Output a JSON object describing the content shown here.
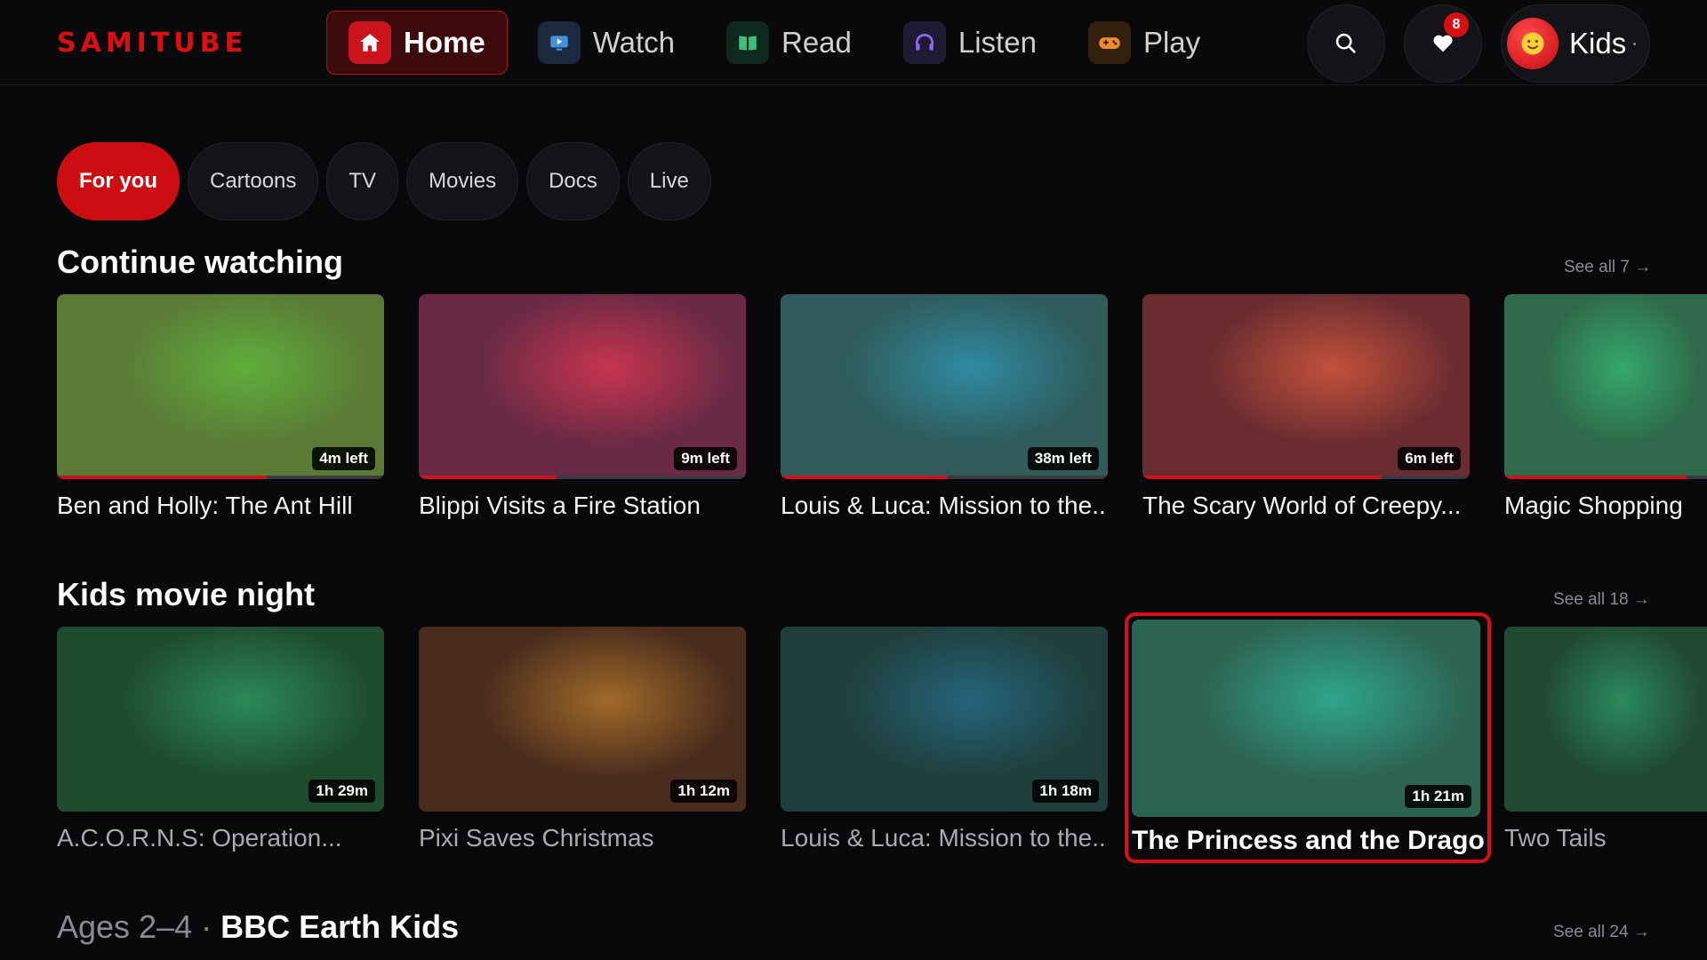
{
  "app": {
    "logo": "SAMITUBE"
  },
  "nav": [
    {
      "label": "Home",
      "icon": "home-icon",
      "color": "#c8141a",
      "active": true
    },
    {
      "label": "Watch",
      "icon": "tv-icon",
      "color": "#1b3a5c"
    },
    {
      "label": "Read",
      "icon": "book-icon",
      "color": "#13382a"
    },
    {
      "label": "Listen",
      "icon": "headphones-icon",
      "color": "#2c2246"
    },
    {
      "label": "Play",
      "icon": "gamepad-icon",
      "color": "#3d2614"
    }
  ],
  "header": {
    "search_icon": "search-icon",
    "favorites_icon": "heart-icon",
    "favorites_count": "8",
    "profile_name": "Kids",
    "avatar_icon": "smiley-icon"
  },
  "chips": [
    "For you",
    "Cartoons",
    "TV",
    "Movies",
    "Docs",
    "Live"
  ],
  "sections": {
    "continue": {
      "title": "Continue watching",
      "see_all": "See all 7 →",
      "items": [
        {
          "title": "Ben and Holly: The Ant Hill",
          "badge": "4m left",
          "progress": 0.64,
          "bg": "#5a7a36",
          "glow": "#5fae3a"
        },
        {
          "title": "Blippi Visits a Fire Station",
          "badge": "9m left",
          "progress": 0.42,
          "bg": "#6a2a45",
          "glow": "#c8344f"
        },
        {
          "title": "Louis & Luca: Mission to the...",
          "badge": "38m left",
          "progress": 0.51,
          "bg": "#2f5b5a",
          "glow": "#2f8aa3"
        },
        {
          "title": "The Scary World of Creepy...",
          "badge": "6m left",
          "progress": 0.73,
          "bg": "#6a2c30",
          "glow": "#c2513b"
        },
        {
          "title": "Magic Shopping",
          "badge": "",
          "progress": 0.9,
          "bg": "#2f6a4a",
          "glow": "#35a86a"
        }
      ]
    },
    "movies": {
      "title": "Kids movie night",
      "see_all": "See all 18 →",
      "items": [
        {
          "title": "A.C.O.R.N.S: Operation...",
          "badge": "1h 29m",
          "bg": "#1f4b2f",
          "glow": "#2a8a56"
        },
        {
          "title": "Pixi Saves Christmas",
          "badge": "1h 12m",
          "bg": "#4a2c1e",
          "glow": "#a06a28"
        },
        {
          "title": "Louis & Luca: Mission to the...",
          "badge": "1h 18m",
          "bg": "#1f3f3c",
          "glow": "#25647c"
        },
        {
          "title": "The Princess and the Dragon",
          "badge": "1h 21m",
          "bg": "#2d6352",
          "glow": "#2fa58c",
          "focused": true
        },
        {
          "title": "Two Tails",
          "badge": "",
          "bg": "#214a33",
          "glow": "#2a8a5c"
        }
      ]
    },
    "earth": {
      "prefix": "Ages 2–4 · ",
      "title": "BBC Earth Kids",
      "see_all": "See all 24 →"
    }
  }
}
